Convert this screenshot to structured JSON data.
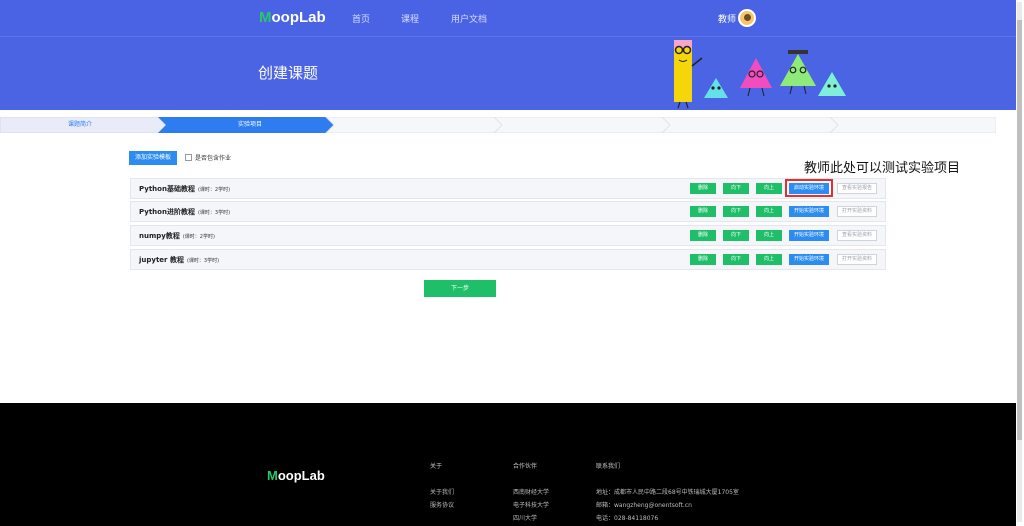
{
  "header": {
    "logo_first": "M",
    "logo_rest": "oopLab",
    "nav": [
      "首页",
      "课程",
      "用户文档"
    ],
    "user_label": "教师"
  },
  "hero": {
    "title": "创建课题"
  },
  "steps": [
    "课题简介",
    "实验项目",
    "",
    "",
    "",
    ""
  ],
  "toolbar": {
    "add_label": "添加实验模板",
    "checkbox_label": "是否包含作业"
  },
  "annotation": "教师此处可以测试实验项目",
  "experiments": [
    {
      "name": "Python基础教程",
      "meta": "(课时：2学时)",
      "delete": "删除",
      "down": "向下",
      "up": "向上",
      "start": "启动实验环境",
      "report": "查看实验报告"
    },
    {
      "name": "Python进阶教程",
      "meta": "(课时：3学时)",
      "delete": "删除",
      "down": "向下",
      "up": "向上",
      "start": "开始实验环境",
      "report": "打开实验资料"
    },
    {
      "name": "numpy教程",
      "meta": "(课时：2学时)",
      "delete": "删除",
      "down": "向下",
      "up": "向上",
      "start": "开始实验环境",
      "report": "查看实验资料"
    },
    {
      "name": "jupyter 教程",
      "meta": "(课时：3学时)",
      "delete": "删除",
      "down": "向下",
      "up": "向上",
      "start": "开始实验环境",
      "report": "打开实验资料"
    }
  ],
  "next_label": "下一步",
  "footer": {
    "logo_first": "M",
    "logo_rest": "oopLab",
    "col1": {
      "title": "关于",
      "items": [
        "关于我们",
        "服务协议"
      ]
    },
    "col2": {
      "title": "合作伙伴",
      "items": [
        "西南财经大学",
        "电子科技大学",
        "四川大学"
      ]
    },
    "col3": {
      "title": "联系我们",
      "items": [
        "地址：成都市人民中路二段68号中铁瑞城大厦1705室",
        "邮箱：wangzheng@onentsoft.cn",
        "电话：028-84118076"
      ]
    }
  },
  "colors": {
    "primary": "#4a63e4",
    "accent_green": "#1fbf6a",
    "button_blue": "#2d8cf0",
    "highlight_red": "#e23030"
  }
}
